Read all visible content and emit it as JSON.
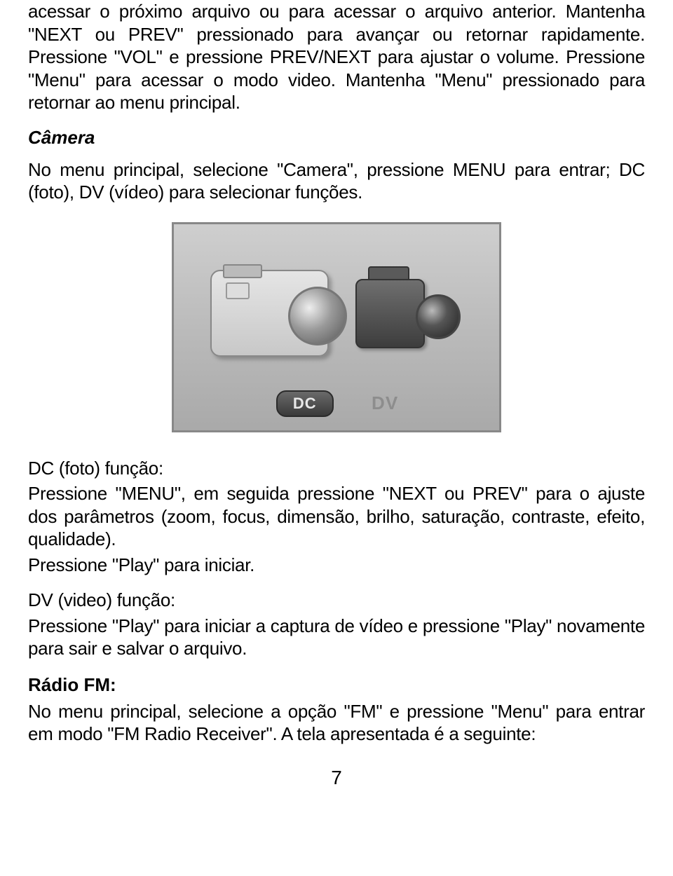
{
  "intro_para": "acessar o próximo arquivo ou para acessar o arquivo anterior. Mantenha \"NEXT ou PREV\" pressionado para avançar ou retornar rapidamente. Pressione \"VOL\" e pressione PREV/NEXT para ajustar o volume. Pressione \"Menu\" para acessar o modo video. Mantenha \"Menu\" pressionado para retornar ao menu principal.",
  "camera": {
    "heading": "Câmera",
    "para": "No menu principal, selecione \"Camera\", pressione MENU para entrar; DC (foto), DV (vídeo) para selecionar funções."
  },
  "figure": {
    "dc_label": "DC",
    "dv_label": "DV"
  },
  "dc": {
    "heading": "DC (foto) função:",
    "para1": "Pressione \"MENU\", em seguida pressione \"NEXT ou PREV\" para o ajuste dos parâmetros (zoom, focus, dimensão, brilho, saturação, contraste, efeito, qualidade).",
    "para2": "Pressione \"Play\" para iniciar."
  },
  "dv": {
    "heading": "DV (video) função:",
    "para": "Pressione \"Play\" para iniciar a captura de vídeo e pressione \"Play\" novamente para sair e salvar o arquivo."
  },
  "radio": {
    "heading": "Rádio FM:",
    "para": "No menu principal, selecione a opção \"FM\" e pressione \"Menu\" para entrar em modo \"FM Radio Receiver\". A tela apresentada é a seguinte:"
  },
  "page_number": "7"
}
